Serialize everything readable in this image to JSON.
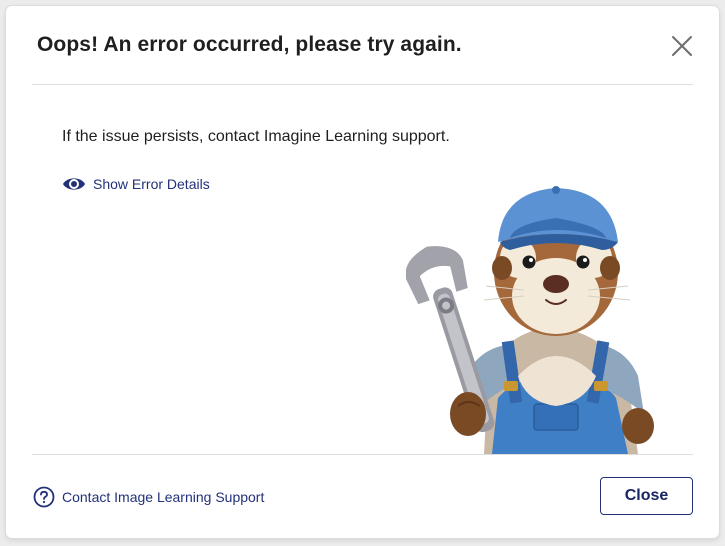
{
  "dialog": {
    "title": "Oops! An error occurred, please try again.",
    "message": "If the issue persists, contact Imagine Learning support.",
    "details_link": "Show Error Details",
    "support_link": "Contact Image Learning Support",
    "close_button": "Close"
  },
  "icons": {
    "close": "close-icon",
    "details": "eye-icon",
    "support": "help-circle-icon",
    "illustration": "otter-mechanic-illustration"
  },
  "colors": {
    "link": "#23317a",
    "button_border": "#23317a",
    "title": "#1f1f1f",
    "divider": "#dedede"
  }
}
